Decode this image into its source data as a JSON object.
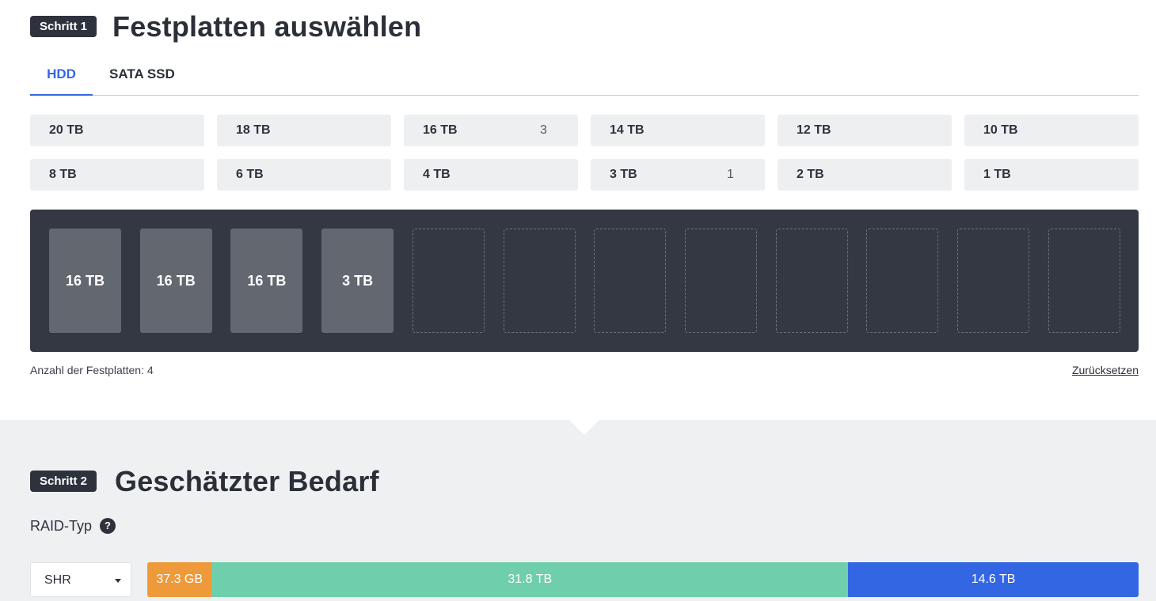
{
  "step1": {
    "badge": "Schritt 1",
    "title": "Festplatten auswählen",
    "tabs": [
      {
        "label": "HDD",
        "active": true
      },
      {
        "label": "SATA SSD",
        "active": false
      }
    ],
    "capacities": [
      {
        "label": "20 TB",
        "count": ""
      },
      {
        "label": "18 TB",
        "count": ""
      },
      {
        "label": "16 TB",
        "count": "3"
      },
      {
        "label": "14 TB",
        "count": ""
      },
      {
        "label": "12 TB",
        "count": ""
      },
      {
        "label": "10 TB",
        "count": ""
      },
      {
        "label": "8 TB",
        "count": ""
      },
      {
        "label": "6 TB",
        "count": ""
      },
      {
        "label": "4 TB",
        "count": ""
      },
      {
        "label": "3 TB",
        "count": "1"
      },
      {
        "label": "2 TB",
        "count": ""
      },
      {
        "label": "1 TB",
        "count": ""
      }
    ],
    "slots": [
      "16 TB",
      "16 TB",
      "16 TB",
      "3 TB",
      "",
      "",
      "",
      "",
      "",
      "",
      "",
      ""
    ],
    "disk_count_text": "Anzahl der Festplatten: 4",
    "reset_label": "Zurücksetzen"
  },
  "step2": {
    "badge": "Schritt 2",
    "title": "Geschätzter Bedarf",
    "raid_label": "RAID-Typ",
    "help_icon": "?",
    "raid_selected": "SHR",
    "usage_segments": [
      {
        "label": "37.3 GB",
        "color": "#ee9a3a",
        "fraction": 0.065
      },
      {
        "label": "31.8 TB",
        "color": "#6fcfac",
        "fraction": 0.642
      },
      {
        "label": "14.6 TB",
        "color": "#3366e2",
        "fraction": 0.293
      }
    ]
  },
  "colors": {
    "accent": "#3567e3",
    "badge": "#2e323d",
    "bay": "#343843",
    "slot_filled": "#636770"
  }
}
